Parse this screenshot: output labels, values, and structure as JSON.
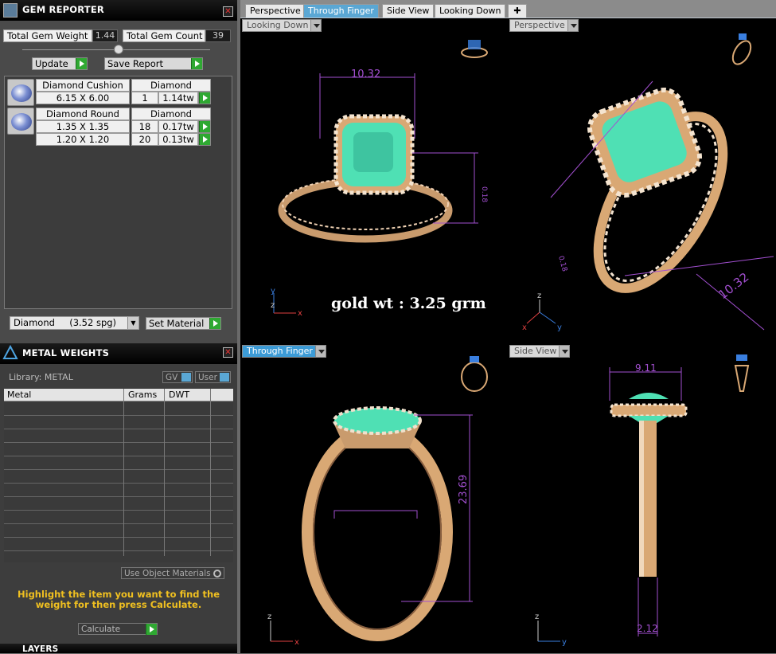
{
  "gem_reporter": {
    "title": "GEM REPORTER",
    "total_weight_label": "Total Gem Weight",
    "total_weight": "1.44",
    "total_count_label": "Total Gem Count",
    "total_count": "39",
    "update": "Update",
    "save_report": "Save Report",
    "groups": [
      {
        "name": "Diamond Cushion",
        "material": "Diamond",
        "rows": [
          {
            "size": "6.15 X 6.00",
            "qty": "1",
            "wt": "1.14tw"
          }
        ]
      },
      {
        "name": "Diamond Round",
        "material": "Diamond",
        "rows": [
          {
            "size": "1.35 X 1.35",
            "qty": "18",
            "wt": "0.17tw"
          },
          {
            "size": "1.20 X 1.20",
            "qty": "20",
            "wt": "0.13tw"
          }
        ]
      }
    ],
    "material_select": "Diamond     (3.52 spg)",
    "set_material": "Set Material"
  },
  "metal_weights": {
    "title": "METAL WEIGHTS",
    "library": "Library: METAL",
    "gv": "GV",
    "user": "User",
    "columns": [
      "Metal",
      "Grams",
      "DWT"
    ],
    "use_object_materials": "Use Object Materials",
    "hint": "Highlight the item you want to find the weight for then press Calculate.",
    "calculate": "Calculate"
  },
  "layers": {
    "title": "LAYERS"
  },
  "tabs": [
    "Perspective",
    "Through Finger",
    "Side View",
    "Looking Down"
  ],
  "viewports": {
    "looking_down": {
      "label": "Looking Down",
      "dim_w": "10.32",
      "dim_h": "0.18",
      "note": "gold wt : 3.25 grm"
    },
    "perspective": {
      "label": "Perspective",
      "dim_a": "10.32",
      "dim_b": "0.18"
    },
    "through_finger": {
      "label": "Through Finger",
      "dim_h": "23.69"
    },
    "side_view": {
      "label": "Side View",
      "dim_top": "9.11",
      "dim_bottom": "2.12"
    }
  },
  "colors": {
    "accent": "#3c9bd6",
    "gold": "#d9a874",
    "gem": "#4fe0b4",
    "dimension": "#a24fd0",
    "hint": "#f0c020"
  }
}
